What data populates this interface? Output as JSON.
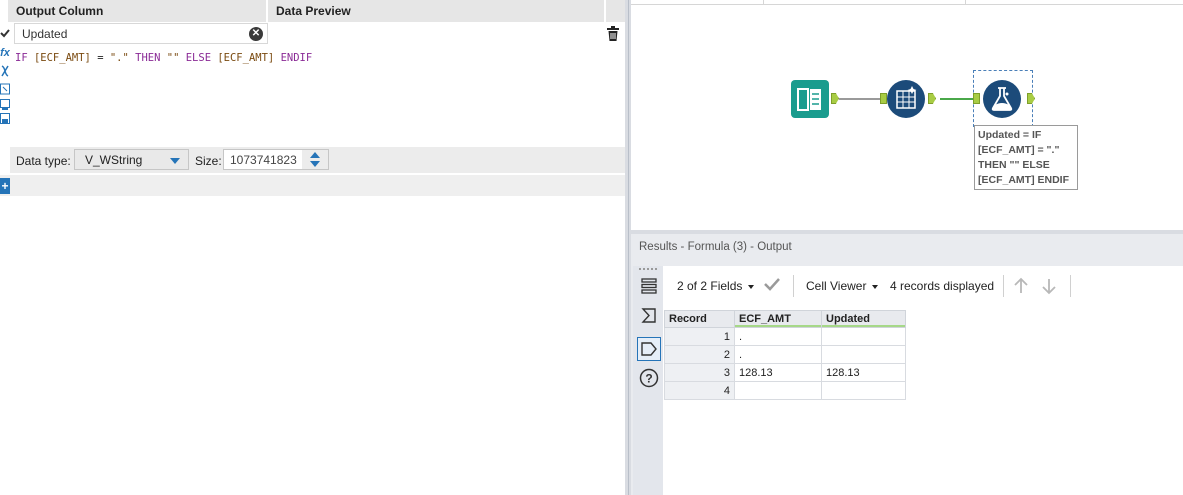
{
  "formula_panel": {
    "headers": {
      "output_column": "Output Column",
      "data_preview": "Data Preview"
    },
    "output_field": "Updated",
    "expression": {
      "p1": "IF ",
      "p2": "[ECF_AMT]",
      "p3": " = ",
      "p4": "\".\"",
      "p5": " THEN ",
      "p6": "\"\"",
      "p7": " ELSE ",
      "p8": "[ECF_AMT]",
      "p9": " ENDIF"
    },
    "data_type_label": "Data type:",
    "data_type_value": "V_WString",
    "size_label": "Size:",
    "size_value": "1073741823",
    "add_icon": "+"
  },
  "canvas": {
    "annotation": [
      "Updated = IF",
      "[ECF_AMT] = \".\"",
      "THEN \"\" ELSE",
      "[ECF_AMT] ENDIF"
    ],
    "tools": [
      "input-data-tool-icon",
      "data-cleansing-tool-icon",
      "formula-tool-icon"
    ]
  },
  "results": {
    "title": "Results - Formula (3) - Output",
    "fields_selector": "2 of 2 Fields",
    "cell_viewer": "Cell Viewer",
    "records_displayed": "4 records displayed",
    "columns": [
      "Record",
      "ECF_AMT",
      "Updated"
    ],
    "rows": [
      [
        "1",
        ".",
        ""
      ],
      [
        "2",
        ".",
        ""
      ],
      [
        "3",
        "128.13",
        "128.13"
      ],
      [
        "4",
        "",
        ""
      ]
    ]
  },
  "colors": {
    "accent_blue": "#2574b8",
    "anchor_green": "#a8cc44",
    "tool_teal": "#1a9c8e",
    "tool_navy": "#1c4b7a"
  }
}
